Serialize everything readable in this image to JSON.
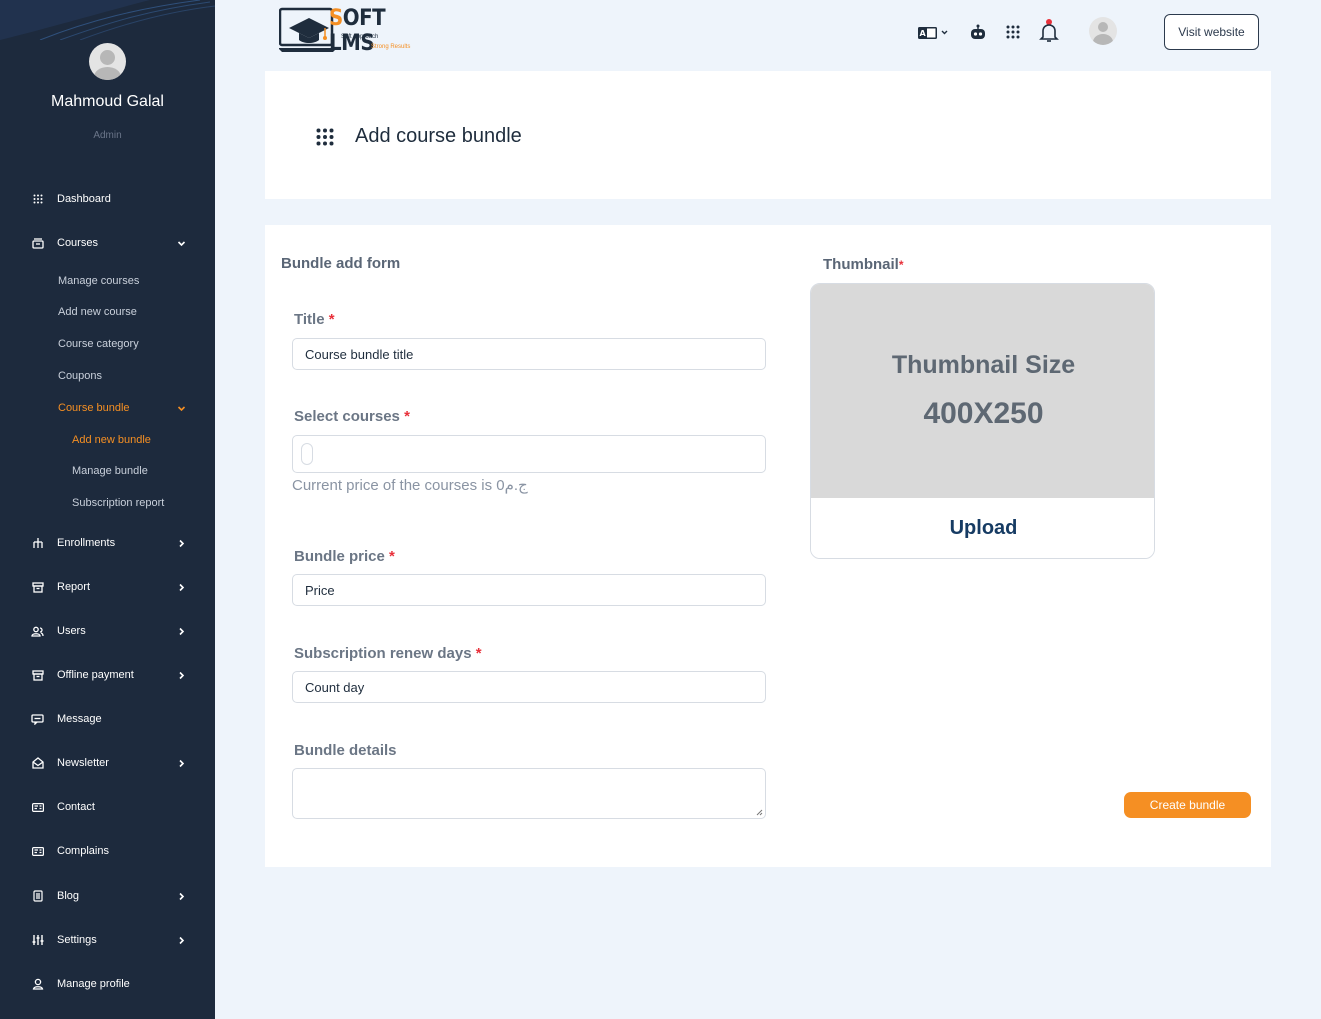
{
  "sidebar": {
    "user_name": "Mahmoud Galal",
    "user_role": "Admin",
    "items": [
      {
        "label": "Dashboard"
      },
      {
        "label": "Courses"
      },
      {
        "label": "Enrollments"
      },
      {
        "label": "Report"
      },
      {
        "label": "Users"
      },
      {
        "label": "Offline payment"
      },
      {
        "label": "Message"
      },
      {
        "label": "Newsletter"
      },
      {
        "label": "Contact"
      },
      {
        "label": "Complains"
      },
      {
        "label": "Blog"
      },
      {
        "label": "Settings"
      },
      {
        "label": "Manage profile"
      }
    ],
    "courses_sub": [
      {
        "label": "Manage courses"
      },
      {
        "label": "Add new course"
      },
      {
        "label": "Course category"
      },
      {
        "label": "Coupons"
      },
      {
        "label": "Course bundle"
      }
    ],
    "bundle_sub": [
      {
        "label": "Add new bundle"
      },
      {
        "label": "Manage bundle"
      },
      {
        "label": "Subscription report"
      }
    ],
    "active_color": "#f58f23"
  },
  "header": {
    "logo_text": "SOFT LMS",
    "logo_tagline": "Soft approach",
    "logo_tagline2": "Strong Results",
    "visit_website": "Visit website"
  },
  "page": {
    "title": "Add course bundle"
  },
  "form": {
    "heading": "Bundle add form",
    "title_label": "Title",
    "title_placeholder": "Course bundle title",
    "select_courses_label": "Select courses",
    "price_note": "Current price of the courses is 0ج.م",
    "bundle_price_label": "Bundle price",
    "bundle_price_placeholder": "Price",
    "renew_days_label": "Subscription renew days",
    "renew_days_placeholder": "Count day",
    "details_label": "Bundle details",
    "required_mark": "*",
    "thumbnail_label": "Thumbnail",
    "thumbnail_size_label": "Thumbnail Size",
    "thumbnail_dim": "400X250",
    "upload_label": "Upload",
    "create_button": "Create bundle"
  }
}
